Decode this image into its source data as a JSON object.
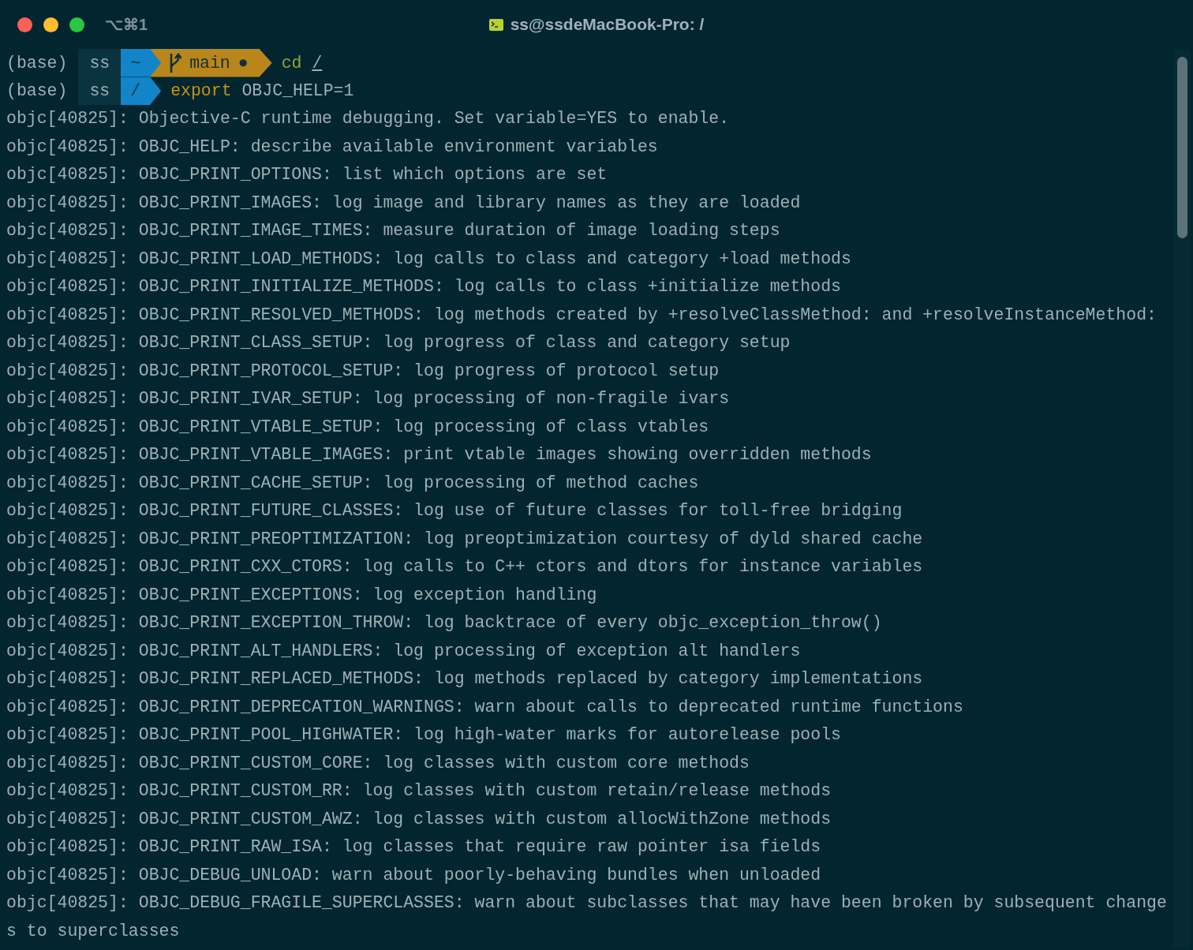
{
  "window": {
    "title": "ss@ssdeMacBook-Pro: /",
    "shortcut": "⌥⌘1"
  },
  "prompts": [
    {
      "env": "(base)",
      "user": "ss",
      "dir": "~",
      "git": {
        "branch": "main",
        "status": "●"
      },
      "command": [
        {
          "text": "cd",
          "kind": "builtin"
        },
        {
          "text": "/",
          "kind": "path"
        }
      ]
    },
    {
      "env": "(base)",
      "user": "ss",
      "dir": "/",
      "command": [
        {
          "text": "export",
          "kind": "keyword"
        },
        {
          "text": "OBJC_HELP=1",
          "kind": "arg"
        }
      ]
    }
  ],
  "output": [
    "objc[40825]: Objective-C runtime debugging. Set variable=YES to enable.",
    "objc[40825]: OBJC_HELP: describe available environment variables",
    "objc[40825]: OBJC_PRINT_OPTIONS: list which options are set",
    "objc[40825]: OBJC_PRINT_IMAGES: log image and library names as they are loaded",
    "objc[40825]: OBJC_PRINT_IMAGE_TIMES: measure duration of image loading steps",
    "objc[40825]: OBJC_PRINT_LOAD_METHODS: log calls to class and category +load methods",
    "objc[40825]: OBJC_PRINT_INITIALIZE_METHODS: log calls to class +initialize methods",
    "objc[40825]: OBJC_PRINT_RESOLVED_METHODS: log methods created by +resolveClassMethod: and +resolveInstanceMethod:",
    "objc[40825]: OBJC_PRINT_CLASS_SETUP: log progress of class and category setup",
    "objc[40825]: OBJC_PRINT_PROTOCOL_SETUP: log progress of protocol setup",
    "objc[40825]: OBJC_PRINT_IVAR_SETUP: log processing of non-fragile ivars",
    "objc[40825]: OBJC_PRINT_VTABLE_SETUP: log processing of class vtables",
    "objc[40825]: OBJC_PRINT_VTABLE_IMAGES: print vtable images showing overridden methods",
    "objc[40825]: OBJC_PRINT_CACHE_SETUP: log processing of method caches",
    "objc[40825]: OBJC_PRINT_FUTURE_CLASSES: log use of future classes for toll-free bridging",
    "objc[40825]: OBJC_PRINT_PREOPTIMIZATION: log preoptimization courtesy of dyld shared cache",
    "objc[40825]: OBJC_PRINT_CXX_CTORS: log calls to C++ ctors and dtors for instance variables",
    "objc[40825]: OBJC_PRINT_EXCEPTIONS: log exception handling",
    "objc[40825]: OBJC_PRINT_EXCEPTION_THROW: log backtrace of every objc_exception_throw()",
    "objc[40825]: OBJC_PRINT_ALT_HANDLERS: log processing of exception alt handlers",
    "objc[40825]: OBJC_PRINT_REPLACED_METHODS: log methods replaced by category implementations",
    "objc[40825]: OBJC_PRINT_DEPRECATION_WARNINGS: warn about calls to deprecated runtime functions",
    "objc[40825]: OBJC_PRINT_POOL_HIGHWATER: log high-water marks for autorelease pools",
    "objc[40825]: OBJC_PRINT_CUSTOM_CORE: log classes with custom core methods",
    "objc[40825]: OBJC_PRINT_CUSTOM_RR: log classes with custom retain/release methods",
    "objc[40825]: OBJC_PRINT_CUSTOM_AWZ: log classes with custom allocWithZone methods",
    "objc[40825]: OBJC_PRINT_RAW_ISA: log classes that require raw pointer isa fields",
    "objc[40825]: OBJC_DEBUG_UNLOAD: warn about poorly-behaving bundles when unloaded",
    "objc[40825]: OBJC_DEBUG_FRAGILE_SUPERCLASSES: warn about subclasses that may have been broken by subsequent changes to superclasses"
  ]
}
